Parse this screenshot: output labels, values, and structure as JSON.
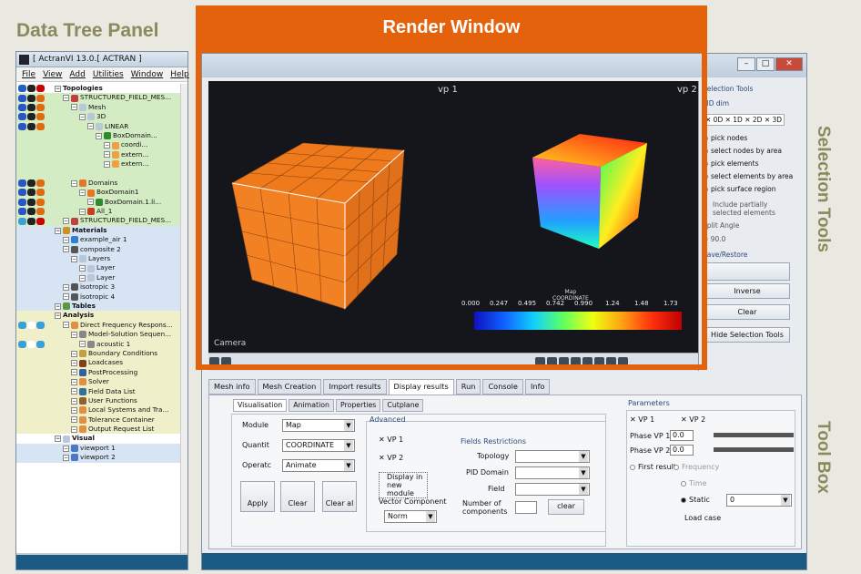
{
  "callouts": {
    "data_tree": "Data Tree Panel",
    "render": "Render Window",
    "selection": "Selection Tools",
    "toolbox": "Tool Box"
  },
  "left": {
    "title": "[ ActranVI 13.0.[ ACTRAN ]",
    "menu": [
      "File",
      "View",
      "Add",
      "Utilities",
      "Window",
      "Help"
    ]
  },
  "tree": [
    {
      "t": "Topologies",
      "d": 0,
      "c": "",
      "h": true,
      "v": [
        "#2060c0",
        "#222",
        "#c00"
      ]
    },
    {
      "t": "STRUCTURED_FIELD_MES...",
      "d": 1,
      "c": "g",
      "ico": "#c04040",
      "v": [
        "#2a55c8",
        "#222",
        "#e06a10"
      ]
    },
    {
      "t": "Mesh",
      "d": 2,
      "c": "g",
      "ico": "#b8c8d8",
      "v": [
        "#2a55c8",
        "#222",
        "#e06a10"
      ]
    },
    {
      "t": "3D",
      "d": 3,
      "c": "g",
      "ico": "#b8c8d8",
      "v": [
        "#2a55c8",
        "#222",
        "#e06a10"
      ]
    },
    {
      "t": "LINEAR",
      "d": 4,
      "c": "g",
      "ico": "#b8c8d8",
      "v": [
        "#2a55c8",
        "#222",
        "#e06a10"
      ]
    },
    {
      "t": "BoxDomain...",
      "d": 5,
      "c": "g",
      "ico": "#2e8a2e",
      "v": []
    },
    {
      "t": "coordi...",
      "d": 6,
      "c": "g",
      "ico": "#f0a040",
      "v": []
    },
    {
      "t": "extern...",
      "d": 6,
      "c": "g",
      "ico": "#f0a040",
      "v": []
    },
    {
      "t": "extern...",
      "d": 6,
      "c": "g",
      "ico": "#f0a040",
      "v": []
    },
    {
      "t": "",
      "d": 0,
      "c": "g",
      "v": []
    },
    {
      "t": "Domains",
      "d": 2,
      "c": "g",
      "ico": "#e07828",
      "v": [
        "#2a55c8",
        "#222",
        "#e06a10"
      ]
    },
    {
      "t": "BoxDomain1",
      "d": 3,
      "c": "g",
      "ico": "#e07828",
      "v": [
        "#2a55c8",
        "#222",
        "#e06a10"
      ]
    },
    {
      "t": "BoxDomain.1.li...",
      "d": 4,
      "c": "g",
      "ico": "#2e8a2e",
      "v": [
        "#2a55c8",
        "#222",
        "#e06a10"
      ]
    },
    {
      "t": "All_1",
      "d": 3,
      "c": "g",
      "ico": "#c04020",
      "v": [
        "#2a55c8",
        "#222",
        "#e06a10"
      ]
    },
    {
      "t": "STRUCTURED_FIELD_MES...",
      "d": 1,
      "c": "g",
      "ico": "#c04040",
      "v": [
        "#3aa0d8",
        "#222",
        "#c00"
      ]
    },
    {
      "t": "Materials",
      "d": 0,
      "c": "b",
      "h": true,
      "ico": "#d09020",
      "v": []
    },
    {
      "t": "example_air 1",
      "d": 1,
      "c": "b",
      "ico": "#3080d0",
      "v": []
    },
    {
      "t": "composite 2",
      "d": 1,
      "c": "b",
      "ico": "#555",
      "v": []
    },
    {
      "t": "Layers",
      "d": 2,
      "c": "b",
      "ico": "#b8c8d8",
      "v": []
    },
    {
      "t": "Layer",
      "d": 3,
      "c": "b",
      "ico": "#b8c8d8",
      "v": []
    },
    {
      "t": "Layer",
      "d": 3,
      "c": "b",
      "ico": "#b8c8d8",
      "v": []
    },
    {
      "t": "isotropic 3",
      "d": 1,
      "c": "b",
      "ico": "#555",
      "v": []
    },
    {
      "t": "isotropic 4",
      "d": 1,
      "c": "b",
      "ico": "#555",
      "v": []
    },
    {
      "t": "Tables",
      "d": 0,
      "c": "b",
      "h": true,
      "ico": "#5a9a3a",
      "v": []
    },
    {
      "t": "Analysis",
      "d": 0,
      "c": "y",
      "h": true,
      "v": []
    },
    {
      "t": "Direct Frequency Respons...",
      "d": 1,
      "c": "y",
      "ico": "#e09040",
      "v": [
        "#3aa0d8",
        "#fff",
        "#3aa0d8"
      ]
    },
    {
      "t": "Model-Solution Sequen...",
      "d": 2,
      "c": "y",
      "ico": "#888",
      "v": []
    },
    {
      "t": "acoustic 1",
      "d": 3,
      "c": "y",
      "ico": "#888",
      "v": [
        "#3aa0d8",
        "#fff",
        "#3aa0d8"
      ]
    },
    {
      "t": "Boundary Conditions",
      "d": 2,
      "c": "y",
      "ico": "#c0a040",
      "v": []
    },
    {
      "t": "Loadcases",
      "d": 2,
      "c": "y",
      "ico": "#804020",
      "v": []
    },
    {
      "t": "PostProcessing",
      "d": 2,
      "c": "y",
      "ico": "#3060a0",
      "v": []
    },
    {
      "t": "Solver",
      "d": 2,
      "c": "y",
      "ico": "#e09040",
      "v": []
    },
    {
      "t": "Field Data List",
      "d": 2,
      "c": "y",
      "ico": "#3070a0",
      "v": []
    },
    {
      "t": "User Functions",
      "d": 2,
      "c": "y",
      "ico": "#906030",
      "v": []
    },
    {
      "t": "Local Systems and Tra...",
      "d": 2,
      "c": "y",
      "ico": "#e09040",
      "v": []
    },
    {
      "t": "Tolerance Container",
      "d": 2,
      "c": "y",
      "ico": "#e09040",
      "v": []
    },
    {
      "t": "Output Request List",
      "d": 2,
      "c": "y",
      "ico": "#e09040",
      "v": []
    },
    {
      "t": "Visual",
      "d": 0,
      "c": "",
      "h": true,
      "ico": "#b8c8d8",
      "v": []
    },
    {
      "t": "viewport 1",
      "d": 1,
      "c": "b",
      "ico": "#4a7abf",
      "v": []
    },
    {
      "t": "viewport 2",
      "d": 1,
      "c": "b",
      "ico": "#4a7abf",
      "v": []
    }
  ],
  "viewport": {
    "vp1": "vp 1",
    "vp2": "vp 2",
    "camera": "Camera",
    "legend_title": "Map\nCOORDINATE",
    "ticks": [
      "0.000",
      "0.247",
      "0.495",
      "0.742",
      "0.990",
      "1.24",
      "1.48",
      "1.73"
    ]
  },
  "selection": {
    "title": "Selection Tools",
    "pid": "PID dim",
    "dims": [
      "0D",
      "1D",
      "2D",
      "3D"
    ],
    "options": [
      "pick nodes",
      "select nodes by area",
      "pick elements",
      "select elements by area",
      "pick surface region"
    ],
    "include": "Include partially selected elements",
    "split": "Split Angle",
    "angle": "90.0",
    "save": "Save/Restore",
    "inverse": "Inverse",
    "clear": "Clear",
    "hide": "Hide Selection Tools"
  },
  "tabs": [
    "Mesh info",
    "Mesh Creation",
    "Import results",
    "Display results",
    "Run",
    "Console",
    "Info"
  ],
  "subtabs": [
    "Visualisation",
    "Animation",
    "Properties",
    "Cutplane"
  ],
  "vis": {
    "module_l": "Module",
    "module_v": "Map",
    "quant_l": "Quantit",
    "quant_v": "COORDINATE",
    "oper_l": "Operatc",
    "oper_v": "Animate",
    "apply": "Apply",
    "clear": "Clear",
    "clearall": "Clear al",
    "advanced": "Advanced",
    "vp1": "VP 1",
    "vp2": "VP 2",
    "display_new": "Display in new module",
    "vector": "Vector Component",
    "norm": "Norm",
    "fr": "Fields Restrictions",
    "topology": "Topology",
    "pid": "PID Domain",
    "field": "Field",
    "ncomp": "Number of components",
    "clearbtn": "clear"
  },
  "params": {
    "title": "Parameters",
    "vp1": "VP 1",
    "vp2": "VP 2",
    "phase1": "Phase VP 1",
    "phase2": "Phase VP 2",
    "p1": "0.0",
    "p2": "0.0",
    "first": "First result",
    "freq": "Frequency",
    "time": "Time",
    "static": "Static",
    "static_v": "0",
    "load": "Load case"
  }
}
